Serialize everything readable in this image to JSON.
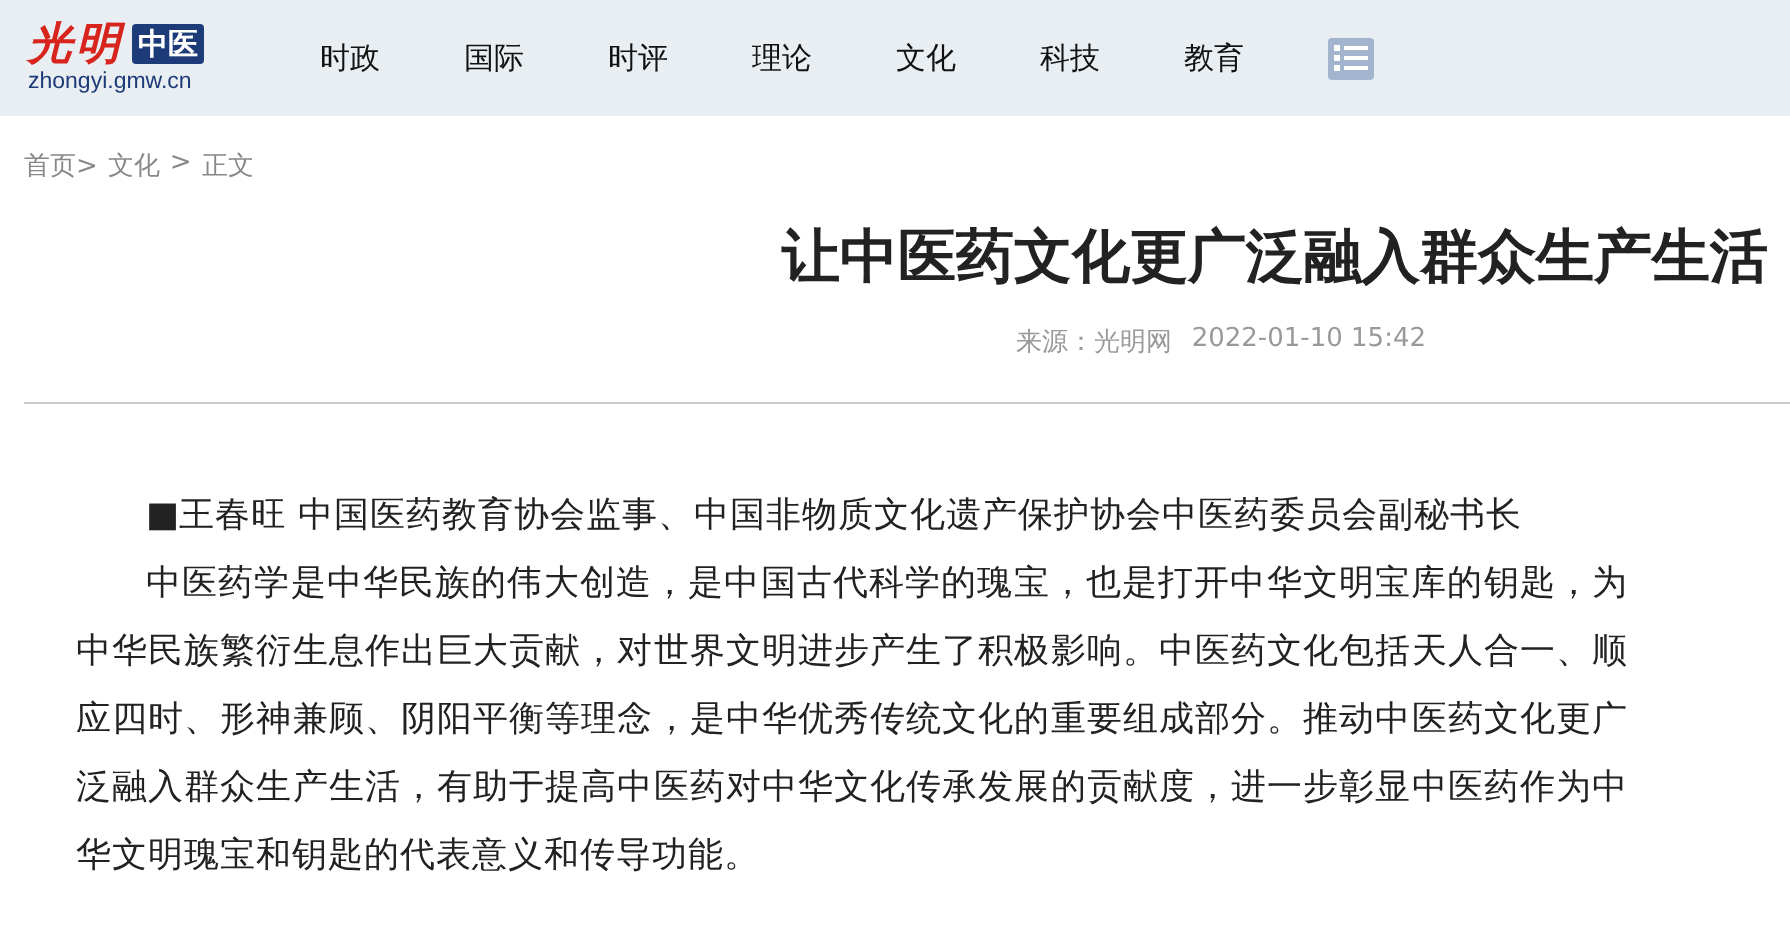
{
  "header": {
    "logo": {
      "script": "光明",
      "badge": "中医",
      "domain": "zhongyi.gmw.cn"
    },
    "nav": [
      {
        "label": "时政"
      },
      {
        "label": "国际"
      },
      {
        "label": "时评"
      },
      {
        "label": "理论"
      },
      {
        "label": "文化"
      },
      {
        "label": "科技"
      },
      {
        "label": "教育"
      }
    ]
  },
  "breadcrumb": [
    "首页>",
    "文化",
    ">",
    "正文"
  ],
  "article": {
    "title": "让中医药文化更广泛融入群众生产生活",
    "source": "来源：光明网",
    "date": "2022-01-10 15:42",
    "paragraphs": [
      "■王春旺 中国医药教育协会监事、中国非物质文化遗产保护协会中医药委员会副秘书长",
      "中医药学是中华民族的伟大创造，是中国古代科学的瑰宝，也是打开中华文明宝库的钥匙，为中华民族繁衍生息作出巨大贡献，对世界文明进步产生了积极影响。中医药文化包括天人合一、顺应四时、形神兼顾、阴阳平衡等理念，是中华优秀传统文化的重要组成部分。推动中医药文化更广泛融入群众生产生活，有助于提高中医药对中华文化传承发展的贡献度，进一步彰显中医药作为中华文明瑰宝和钥匙的代表意义和传导功能。"
    ]
  }
}
